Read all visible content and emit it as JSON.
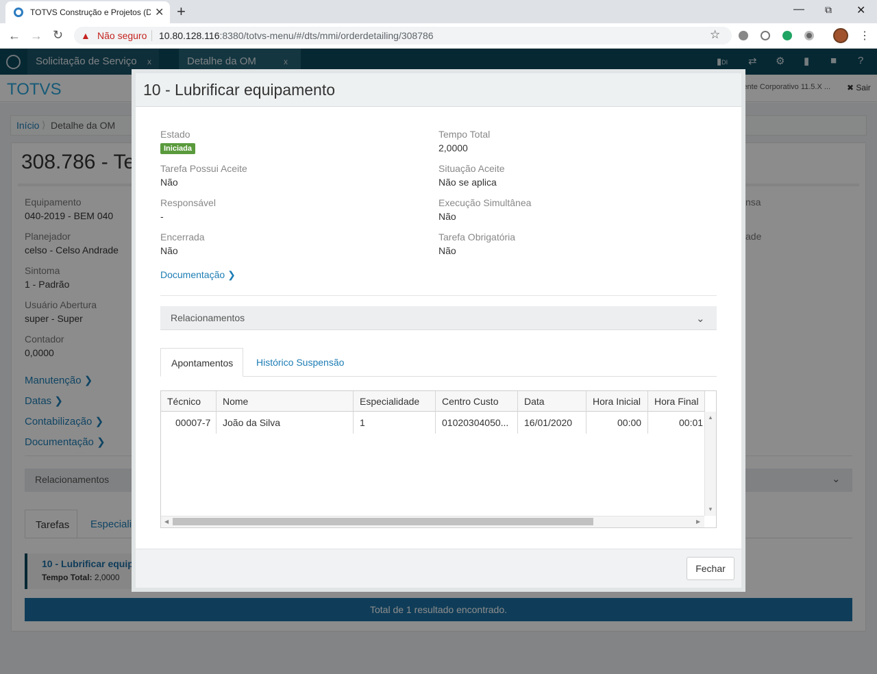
{
  "browser": {
    "tab_title": "TOTVS Construção e Projetos (Da",
    "close_glyph": "✕",
    "new_tab_glyph": "+",
    "security_warning": "Não seguro",
    "url_host": "10.80.128.116",
    "url_rest": ":8380/totvs-menu/#/dts/mmi/orderdetailing/308786"
  },
  "app": {
    "tabs": [
      {
        "label": "Solicitação de Serviço",
        "close": "x"
      },
      {
        "label": "Detalhe da OM",
        "close": "x"
      }
    ],
    "toolbar_di": "DI",
    "brand": "TOTVS",
    "environment": "iente Corporativo 11.5.X ...",
    "logout": "✖ Sair",
    "breadcrumb": {
      "home": "Início",
      "current": "Detalhe da OM"
    },
    "order_title": "308.786 - Te",
    "fields": [
      {
        "label": "Equipamento",
        "value": "040-2019 - BEM 040"
      },
      {
        "label": "Planejador",
        "value": "celso - Celso Andrade"
      },
      {
        "label": "Sintoma",
        "value": "1 - Padrão"
      },
      {
        "label": "Usuário Abertura",
        "value": "super - Super"
      },
      {
        "label": "Contador",
        "value": "0,0000"
      }
    ],
    "partial_labels": [
      "nsa",
      "ade"
    ],
    "links": [
      "Manutenção",
      "Datas",
      "Contabilização",
      "Documentação"
    ],
    "relationships": "Relacionamentos",
    "tabs_bottom": [
      "Tarefas",
      "Especialid"
    ],
    "task": {
      "name": "10 - Lubrificar equipa",
      "time_label": "Tempo Total:",
      "time_value": "2,0000"
    },
    "total": "Total de 1 resultado encontrado."
  },
  "modal": {
    "title": "10 - Lubrificar equipamento",
    "fields_left": [
      {
        "label": "Estado",
        "value": "Iniciada"
      },
      {
        "label": "Tarefa Possui Aceite",
        "value": "Não"
      },
      {
        "label": "Responsável",
        "value": "-"
      },
      {
        "label": "Encerrada",
        "value": "Não"
      }
    ],
    "fields_right": [
      {
        "label": "Tempo Total",
        "value": "2,0000"
      },
      {
        "label": "Situação Aceite",
        "value": "Não se aplica"
      },
      {
        "label": "Execução Simultânea",
        "value": "Não"
      },
      {
        "label": "Tarefa Obrigatória",
        "value": "Não"
      }
    ],
    "doc_link": "Documentação",
    "relationships": "Relacionamentos",
    "tabs": [
      "Apontamentos",
      "Histórico Suspensão"
    ],
    "grid": {
      "columns": [
        "Técnico",
        "Nome",
        "Especialidade",
        "Centro Custo",
        "Data",
        "Hora Inicial",
        "Hora Final"
      ],
      "rows": [
        [
          "00007-7",
          "João da Silva",
          "1",
          "01020304050...",
          "16/01/2020",
          "00:00",
          "00:01"
        ]
      ]
    },
    "close_button": "Fechar"
  }
}
